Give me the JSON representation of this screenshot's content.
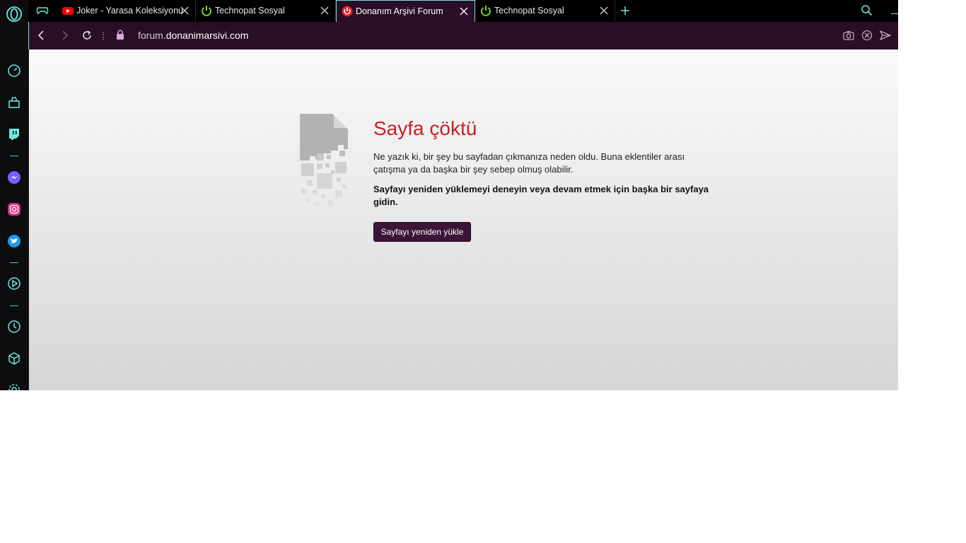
{
  "tabs": [
    {
      "title": "Joker - Yarasa Koleksiyonu",
      "favicon": "youtube-icon",
      "active": false
    },
    {
      "title": "Technopat Sosyal",
      "favicon": "power-icon",
      "active": false
    },
    {
      "title": "Donanım Arşivi Forum",
      "favicon": "power-red-icon",
      "active": true
    },
    {
      "title": "Technopat Sosyal",
      "favicon": "power-icon",
      "active": false
    }
  ],
  "address_bar": {
    "url_prefix": "forum.",
    "url_host": "donanimarsivi.com"
  },
  "crash_page": {
    "title": "Sayfa çöktü",
    "description": "Ne yazık ki, bir şey bu sayfadan çıkmanıza neden oldu. Buna eklentiler arası çatışma ya da başka bir şey sebep olmuş olabilir.",
    "hint": "Sayfayı yeniden yüklemeyi deneyin veya devam etmek için başka bir sayfaya gidin.",
    "reload_label": "Sayfayı yeniden yükle"
  },
  "colors": {
    "accent": "#6de8da",
    "toolbar": "#2a0d27",
    "error_title": "#c42126",
    "button": "#3b1438"
  }
}
